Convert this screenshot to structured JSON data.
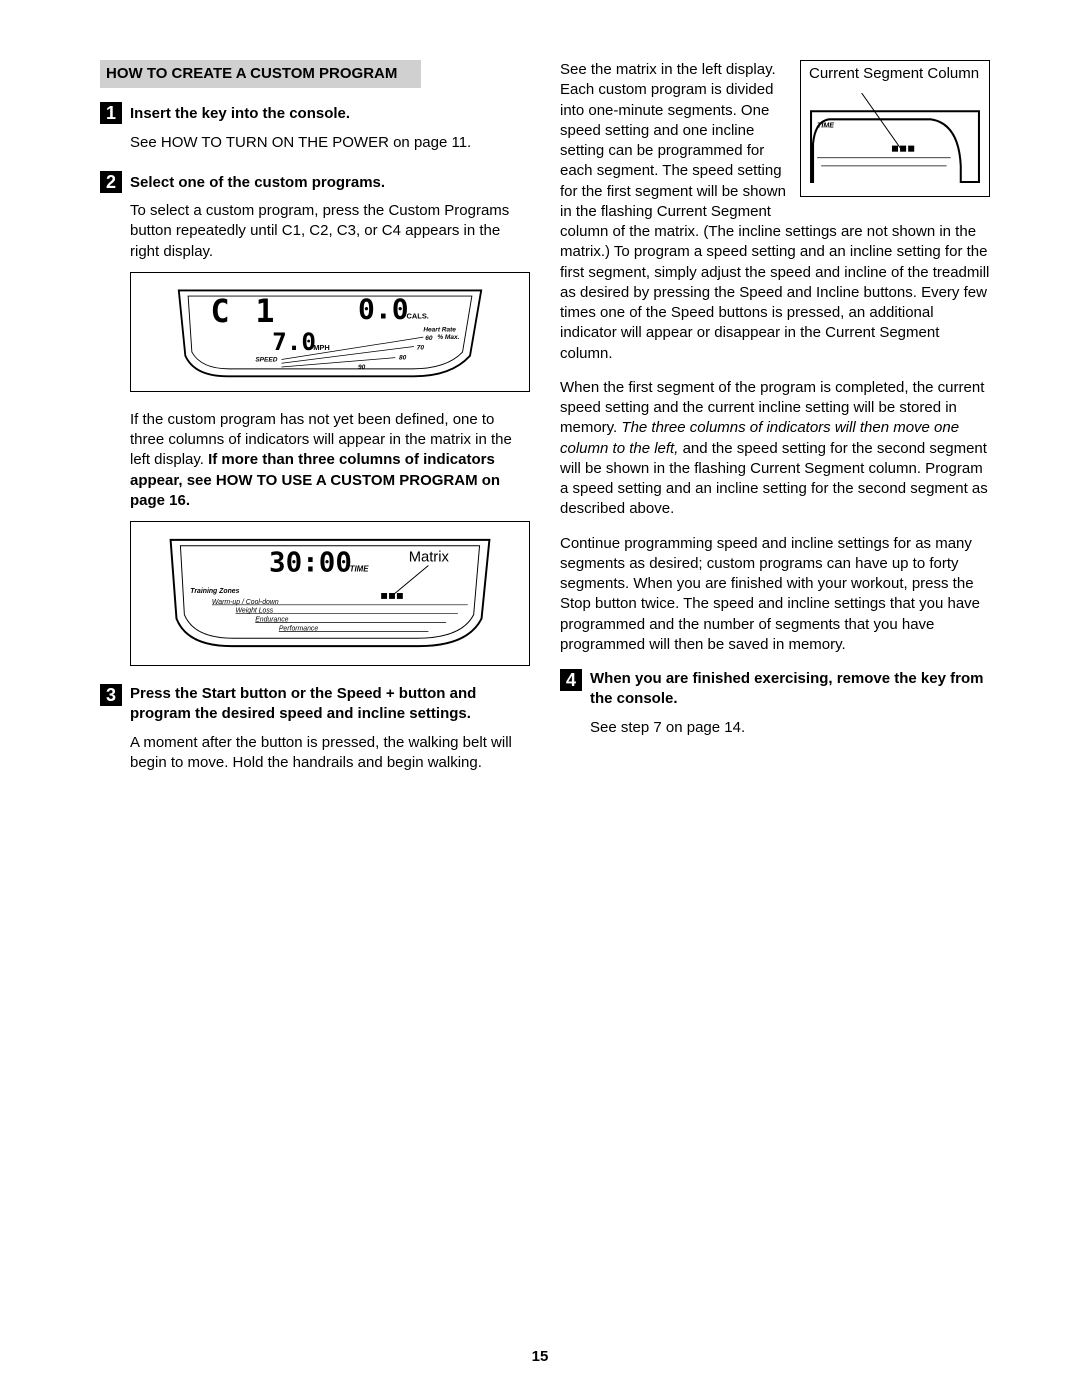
{
  "header": "HOW TO CREATE A CUSTOM PROGRAM",
  "page_number": "15",
  "steps": {
    "s1": {
      "num": "1",
      "title": "Insert the key into the console.",
      "body": "See HOW TO TURN ON THE POWER on page 11."
    },
    "s2": {
      "num": "2",
      "title": "Select one of the custom programs.",
      "body1": "To select a custom program, press the Custom Programs button repeatedly until  C1,   C2,   C3, or  C4  appears in the right display.",
      "body2a": "If the custom program has not yet been defined, one to three columns of indicators will appear in the matrix in the left display. ",
      "body2b": "If more than three columns of indicators appear, see HOW TO USE A CUSTOM PROGRAM on page 16."
    },
    "s3": {
      "num": "3",
      "title": "Press the Start button or the Speed + button and program the desired speed and incline settings.",
      "body": "A moment after the button is pressed, the walking belt will begin to move. Hold the handrails and begin walking."
    },
    "s4": {
      "num": "4",
      "title": "When you are finished exercising, remove the key from the console.",
      "body": "See step 7 on page 14."
    }
  },
  "rightcol": {
    "p1": "See the matrix in the left display. Each custom program is divided into one-minute segments. One speed setting and one incline setting can be programmed for each segment. The speed setting for the first segment will be shown in the flashing Current Segment column of the matrix. (The incline settings are not shown in the matrix.) To program a speed setting and an incline setting for the first segment, simply adjust the speed and incline of the treadmill as desired by pressing the Speed and Incline buttons. Every few times one of the Speed buttons is pressed, an additional indicator will appear or disappear in the Current Segment column.",
    "p2a": "When the first segment of the program is completed, the current speed setting and the current incline setting will be stored in memory. ",
    "p2b": "The three columns of indicators will then move one column to the left,",
    "p2c": " and the speed setting for the second segment will be shown in the flashing Current Segment column. Program a speed setting and an incline setting for the second segment as described above.",
    "p3": "Continue programming speed and incline settings for as many segments as desired; custom programs can have up to forty segments. When you are finished with your workout, press the Stop button twice. The speed and incline settings that you have programmed and the number of segments that you have programmed will then be saved in memory."
  },
  "figs": {
    "inset_caption": "Current Segment Column",
    "inset_time": "TIME",
    "f1": {
      "cals": "CALS.",
      "mph": "MPH",
      "speed": "SPEED",
      "hr": "Heart Rate",
      "max": "% Max.",
      "n60": "60",
      "n70": "70",
      "n80": "80",
      "n90": "90",
      "c_glyph": "C",
      "one_glyph": "1",
      "zero": "0.0",
      "seven": "7.0"
    },
    "f2": {
      "time_val": "30:00",
      "time_lbl": "TIME",
      "matrix": "Matrix",
      "tz": "Training Zones",
      "warm": "Warm-up / Cool-down",
      "weight": "Weight Loss",
      "endur": "Endurance",
      "perf": "Performance"
    }
  }
}
